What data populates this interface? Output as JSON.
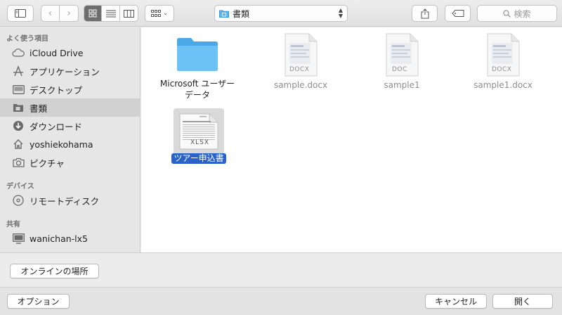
{
  "toolbar": {
    "location": "書類",
    "search_placeholder": "検索"
  },
  "sidebar": {
    "sections": [
      {
        "title": "よく使う項目"
      },
      {
        "title": "デバイス"
      },
      {
        "title": "共有"
      }
    ],
    "favorites": [
      {
        "label": "iCloud Drive",
        "icon": "cloud-icon"
      },
      {
        "label": "アプリケーション",
        "icon": "applications-icon"
      },
      {
        "label": "デスクトップ",
        "icon": "desktop-icon"
      },
      {
        "label": "書類",
        "icon": "documents-icon",
        "selected": true
      },
      {
        "label": "ダウンロード",
        "icon": "download-icon"
      },
      {
        "label": "yoshiekohama",
        "icon": "home-icon"
      },
      {
        "label": "ピクチャ",
        "icon": "camera-icon"
      }
    ],
    "devices": [
      {
        "label": "リモートディスク",
        "icon": "disc-icon"
      }
    ],
    "shared": [
      {
        "label": "wanichan-lx5",
        "icon": "computer-icon"
      }
    ]
  },
  "files": [
    {
      "name_line1": "Microsoft ユーザー",
      "name_line2": "データ",
      "type": "folder"
    },
    {
      "name": "sample.docx",
      "type": "docx",
      "badge": "DOCX"
    },
    {
      "name": "sample1",
      "type": "doc",
      "badge": "DOC"
    },
    {
      "name": "sample1.docx",
      "type": "docx",
      "badge": "DOCX"
    },
    {
      "name": "ツアー申込書",
      "type": "xlsx",
      "badge": "XLSX",
      "selected": true
    }
  ],
  "footer": {
    "online_locations": "オンラインの場所",
    "options": "オプション",
    "cancel": "キャンセル",
    "open": "開く"
  },
  "colors": {
    "folder": "#5ab4ef",
    "selection": "#2a62c9"
  }
}
